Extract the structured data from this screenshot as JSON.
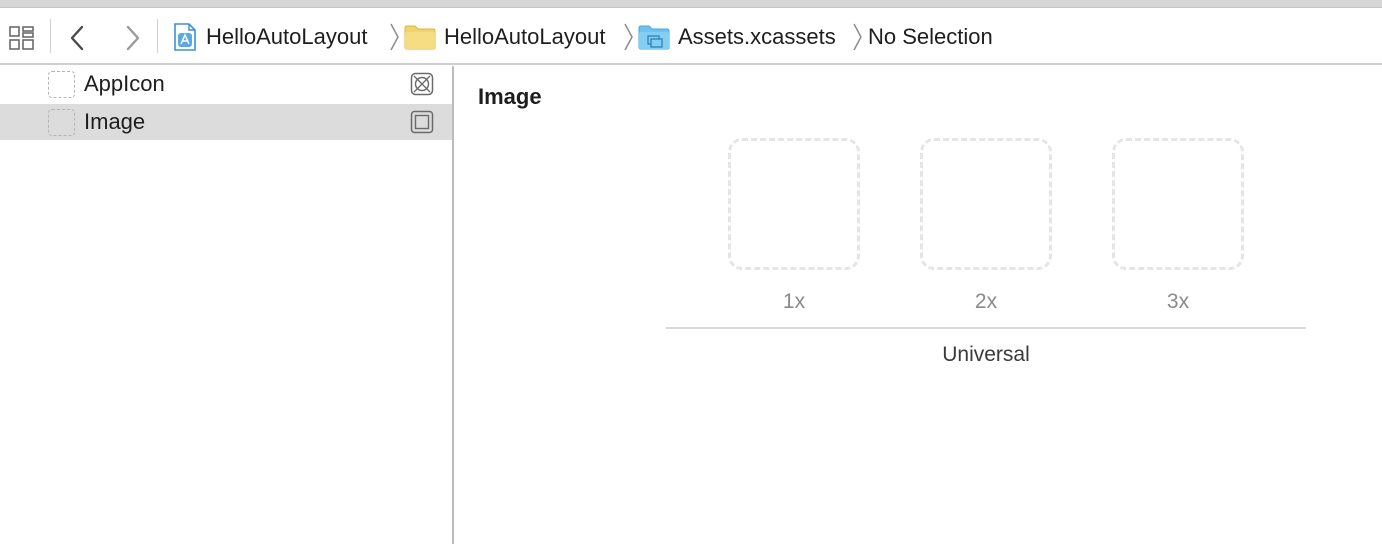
{
  "toolbar": {
    "related_items_icon": "related-items-grid-icon",
    "back_icon": "chevron-left-icon",
    "forward_icon": "chevron-right-icon"
  },
  "breadcrumb": [
    {
      "label": "HelloAutoLayout",
      "icon": "project-file-icon"
    },
    {
      "label": "HelloAutoLayout",
      "icon": "folder-icon"
    },
    {
      "label": "Assets.xcassets",
      "icon": "asset-catalog-icon"
    },
    {
      "label": "No Selection",
      "icon": ""
    }
  ],
  "navigator": {
    "items": [
      {
        "label": "AppIcon",
        "type_icon": "app-icon-set-icon",
        "selected": false
      },
      {
        "label": "Image",
        "type_icon": "image-set-icon",
        "selected": true
      }
    ]
  },
  "editor": {
    "title": "Image",
    "slots": [
      {
        "label": "1x"
      },
      {
        "label": "2x"
      },
      {
        "label": "3x"
      }
    ],
    "group_label": "Universal"
  },
  "colors": {
    "folder": "#f3d36e",
    "asset_catalog": "#6cc3ee",
    "project_file": "#3d8fd6",
    "selection": "#dcdcdc"
  }
}
